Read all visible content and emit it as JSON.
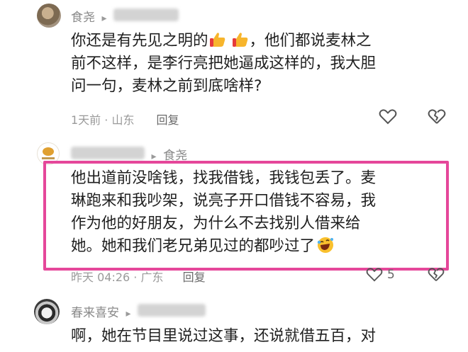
{
  "comment1": {
    "username": "食尧",
    "text_line1": "你还是有先见之明的",
    "text_line1_after": "，他们都说麦林之",
    "text_line2": "前不这样，是李行亮把她逼成这样的，我大胆",
    "text_line3": "问一句，麦林之前到底啥样?",
    "time_location": "1天前 · 山东",
    "reply_label": "回复"
  },
  "comment2": {
    "reply_to": "食尧",
    "text_line1": "他出道前没啥钱，找我借钱，我钱包丢了。麦",
    "text_line2": "琳跑来和我吵架，说亮子开口借钱不容易，我",
    "text_line3": "作为他的好朋友，为什么不去找别人借来给",
    "text_line4": "她。她和我们老兄弟见过的都吵过了",
    "time_location": "昨天 04:26 · 广东",
    "reply_label": "回复",
    "like_count": "5"
  },
  "comment3": {
    "username": "春来喜安",
    "text_line1": "啊，她在节目里说过这事，还说就借五百，对"
  },
  "colors": {
    "highlight": "#e5479a",
    "meta": "#9a9a9a"
  },
  "icons": [
    "heart-outline-icon",
    "broken-heart-icon",
    "thumbs-up-emoji",
    "laughing-emoji",
    "reply-arrow-icon"
  ]
}
